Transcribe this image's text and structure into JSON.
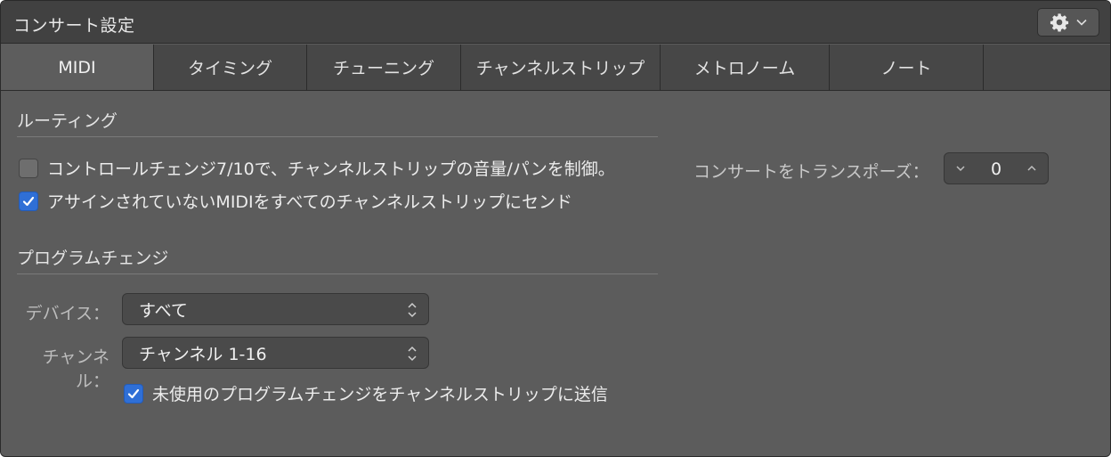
{
  "window": {
    "title": "コンサート設定"
  },
  "tabs": [
    {
      "label": "MIDI",
      "active": true
    },
    {
      "label": "タイミング",
      "active": false
    },
    {
      "label": "チューニング",
      "active": false
    },
    {
      "label": "チャンネルストリップ",
      "active": false
    },
    {
      "label": "メトロノーム",
      "active": false
    },
    {
      "label": "ノート",
      "active": false
    }
  ],
  "routing": {
    "title": "ルーティング",
    "cc_control": {
      "label": "コントロールチェンジ7/10で、チャンネルストリップの音量/パンを制御。",
      "checked": false
    },
    "send_unassigned": {
      "label": "アサインされていないMIDIをすべてのチャンネルストリップにセンド",
      "checked": true
    }
  },
  "program_change": {
    "title": "プログラムチェンジ",
    "device": {
      "label": "デバイス：",
      "value": "すべて"
    },
    "channel": {
      "label": "チャンネル：",
      "value": "チャンネル 1-16"
    },
    "send_unused": {
      "label": "未使用のプログラムチェンジをチャンネルストリップに送信",
      "checked": true
    }
  },
  "transpose": {
    "label": "コンサートをトランスポーズ：",
    "value": "0"
  },
  "colors": {
    "accent": "#2f6fd6",
    "background": "#5c5c5c",
    "titlebar": "#414141"
  },
  "icons": {
    "action": "gear-icon",
    "popup": "up-down-chevron-icon"
  }
}
